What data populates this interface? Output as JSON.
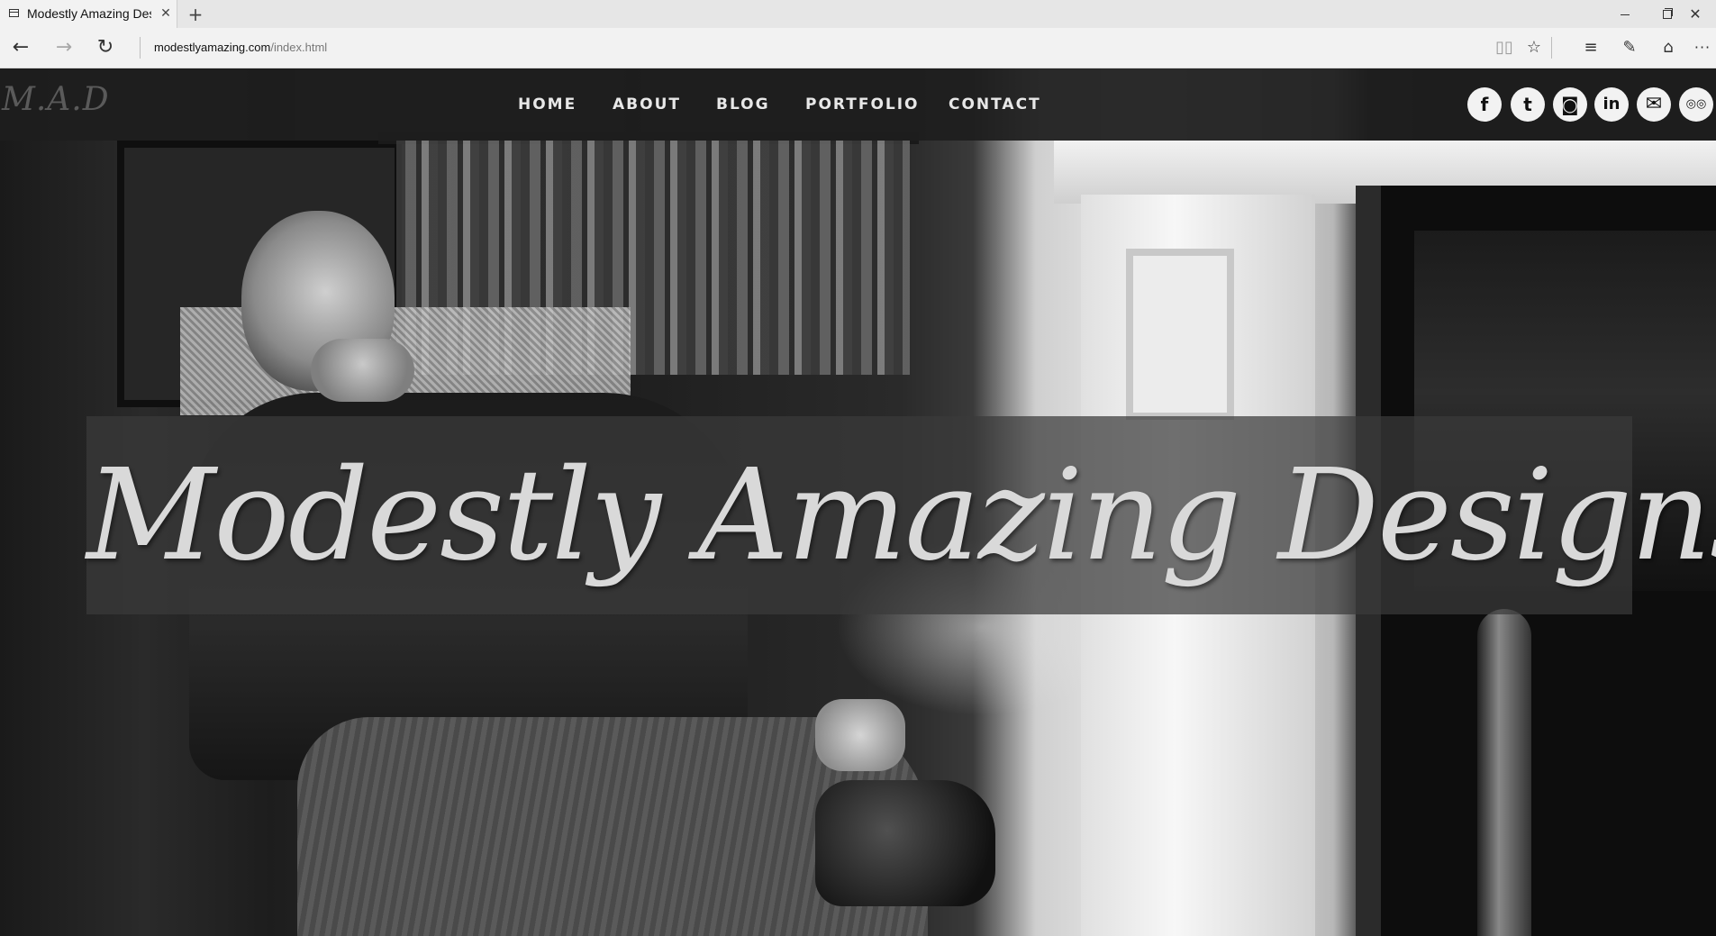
{
  "browser": {
    "tab": {
      "title": "Modestly Amazing Desi",
      "close_glyph": "✕"
    },
    "new_tab_glyph": "+",
    "window": {
      "minimize": "",
      "maximize": "",
      "close_glyph": "✕"
    },
    "nav": {
      "back_glyph": "←",
      "forward_glyph": "→",
      "refresh_glyph": "↻"
    },
    "url": {
      "host": "modestlyamazing.com",
      "path": "/index.html"
    },
    "tools": {
      "reading_view_glyph": "▯▯",
      "favorite_glyph": "☆",
      "hub_glyph": "≡",
      "web_note_glyph": "✎",
      "share_glyph": "⌂",
      "more_glyph": "···"
    }
  },
  "site": {
    "logo": "M.A.D",
    "menu": [
      "HOME",
      "ABOUT",
      "BLOG",
      "PORTFOLIO",
      "CONTACT"
    ],
    "social": {
      "facebook": "f",
      "twitter": "t",
      "instagram": "◙",
      "linkedin": "in",
      "email": "✉",
      "tripadvisor": "◎◎"
    },
    "hero_title": "Modestly Amazing Designs"
  }
}
